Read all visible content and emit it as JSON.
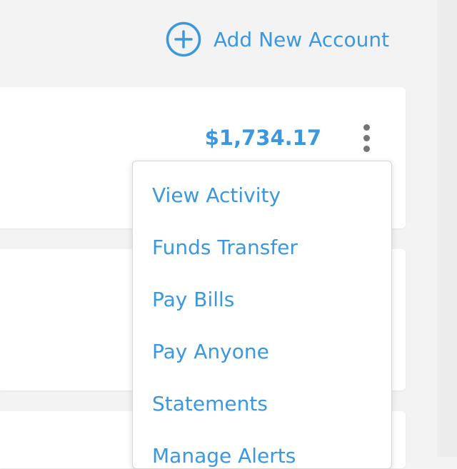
{
  "header": {
    "add_account_icon": "plus-circle-icon",
    "add_account_label": "Add New Account"
  },
  "accounts": [
    {
      "balance": "$1,734.17",
      "menu_icon": "more-vertical-icon"
    }
  ],
  "account_menu": {
    "items": [
      {
        "label": "View Activity"
      },
      {
        "label": "Funds Transfer"
      },
      {
        "label": "Pay Bills"
      },
      {
        "label": "Pay Anyone"
      },
      {
        "label": "Statements"
      },
      {
        "label": "Manage Alerts"
      }
    ]
  },
  "colors": {
    "accent": "#3a97e0",
    "background": "#f3f3f3",
    "card": "#ffffff",
    "kebab": "#757575"
  }
}
